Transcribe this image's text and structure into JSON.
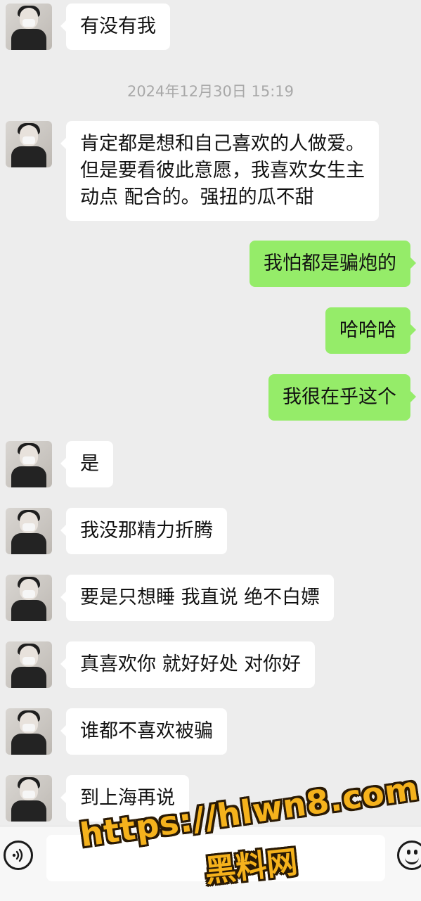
{
  "chat": {
    "timestamp": "2024年12月30日 15:19",
    "messages": [
      {
        "side": "left",
        "text": "有没有我"
      },
      {
        "side": "left",
        "text": "肯定都是想和自己喜欢的人做爱。\n但是要看彼此意愿，我喜欢女生主\n动点 配合的。强扭的瓜不甜"
      },
      {
        "side": "right",
        "text": "我怕都是骗炮的"
      },
      {
        "side": "right",
        "text": "哈哈哈"
      },
      {
        "side": "right",
        "text": "我很在乎这个"
      },
      {
        "side": "left",
        "text": "是"
      },
      {
        "side": "left",
        "text": "我没那精力折腾"
      },
      {
        "side": "left",
        "text": "要是只想睡 我直说 绝不白嫖"
      },
      {
        "side": "left",
        "text": "真喜欢你 就好好处 对你好"
      },
      {
        "side": "left",
        "text": "谁都不喜欢被骗"
      },
      {
        "side": "left",
        "text": "到上海再说"
      }
    ]
  },
  "input_bar": {
    "voice_icon": "voice-icon",
    "input_value": "",
    "emoji_icon": "emoji-icon"
  },
  "watermark": {
    "url": "https://hlwn8.com",
    "site_name": "黑料网"
  },
  "colors": {
    "background": "#ededed",
    "bubble_incoming": "#ffffff",
    "bubble_outgoing": "#95ec69",
    "timestamp": "#a8a8a8",
    "watermark": "#f5b21c"
  }
}
